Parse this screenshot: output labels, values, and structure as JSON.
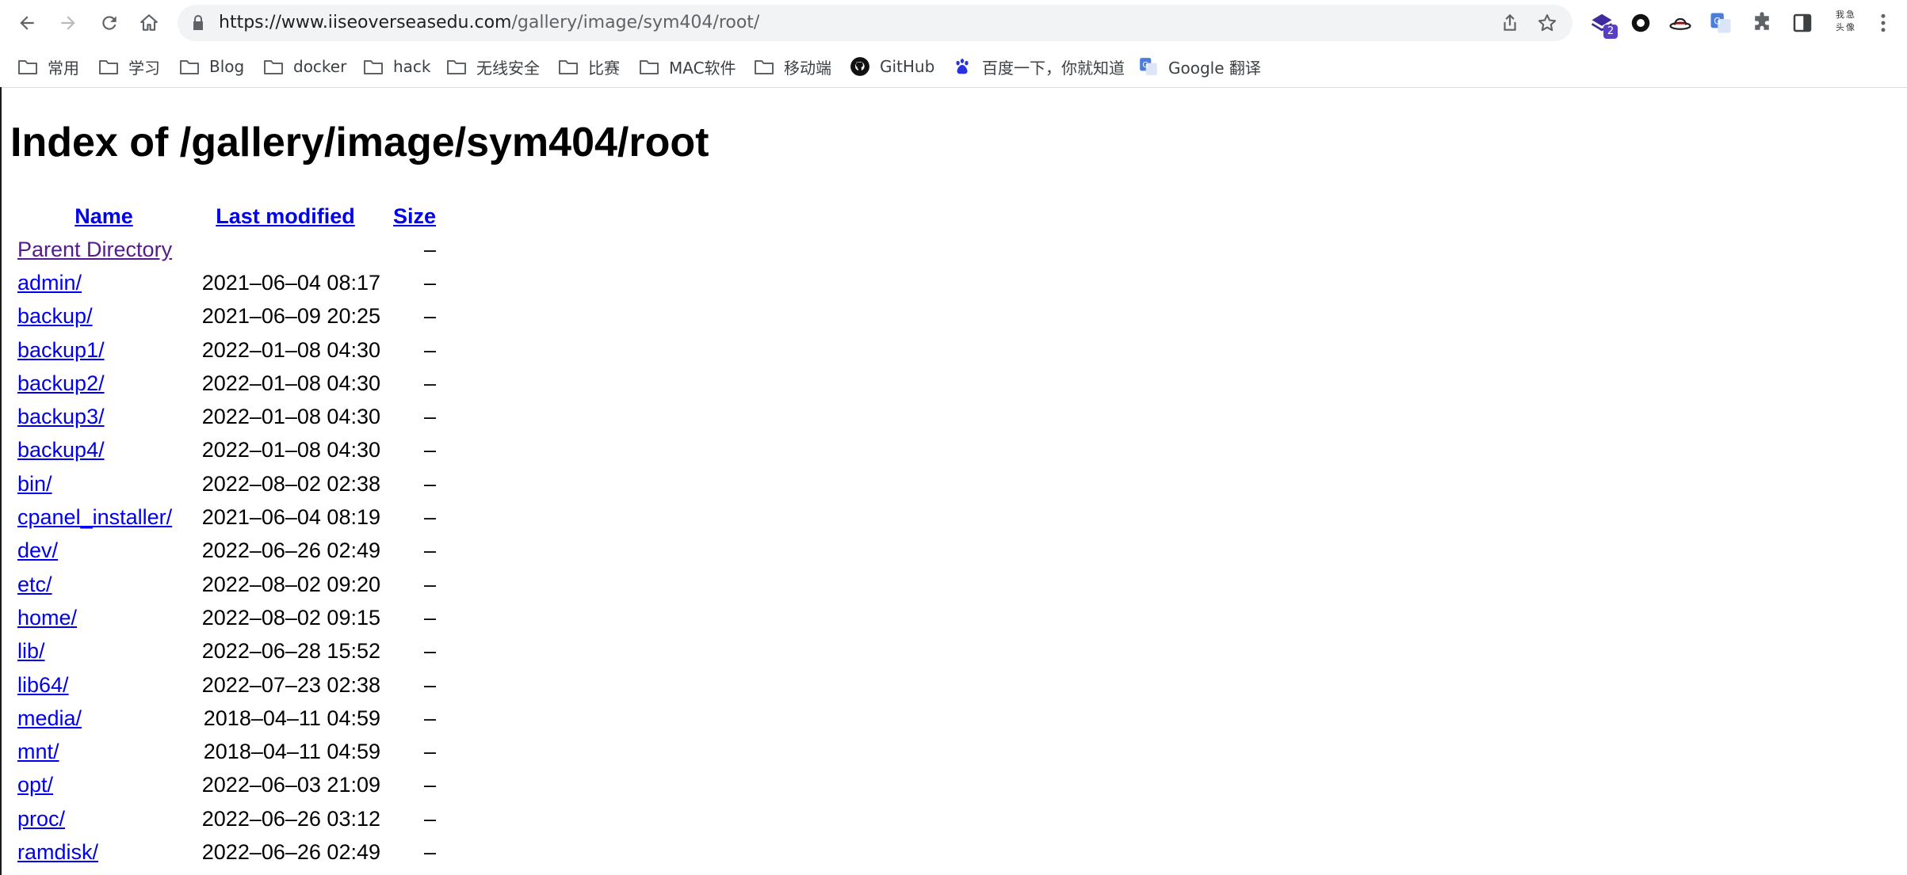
{
  "browser": {
    "url_host": "https://www.iiseoverseasedu.com",
    "url_path": "/gallery/image/sym404/root/",
    "extension_badge": "2",
    "profile_label": "我急头像"
  },
  "bookmarks": [
    {
      "label": "常用",
      "icon": "folder-icon"
    },
    {
      "label": "学习",
      "icon": "folder-icon"
    },
    {
      "label": "Blog",
      "icon": "folder-icon"
    },
    {
      "label": "docker",
      "icon": "folder-icon"
    },
    {
      "label": "hack",
      "icon": "folder-icon"
    },
    {
      "label": "无线安全",
      "icon": "folder-icon"
    },
    {
      "label": "比赛",
      "icon": "folder-icon"
    },
    {
      "label": "MAC软件",
      "icon": "folder-icon"
    },
    {
      "label": "移动端",
      "icon": "folder-icon"
    },
    {
      "label": "GitHub",
      "icon": "github-icon"
    },
    {
      "label": "百度一下，你就知道",
      "icon": "baidu-paw-icon"
    },
    {
      "label": "Google 翻译",
      "icon": "google-translate-icon"
    }
  ],
  "page": {
    "title": "Index of /gallery/image/sym404/root",
    "columns": {
      "name": "Name",
      "modified": "Last modified",
      "size": "Size"
    },
    "parent": {
      "name": "Parent Directory",
      "size": "–"
    },
    "rows": [
      {
        "name": "admin/",
        "modified": "2021–06–04 08:17",
        "size": "–"
      },
      {
        "name": "backup/",
        "modified": "2021–06–09 20:25",
        "size": "–"
      },
      {
        "name": "backup1/",
        "modified": "2022–01–08 04:30",
        "size": "–"
      },
      {
        "name": "backup2/",
        "modified": "2022–01–08 04:30",
        "size": "–"
      },
      {
        "name": "backup3/",
        "modified": "2022–01–08 04:30",
        "size": "–"
      },
      {
        "name": "backup4/",
        "modified": "2022–01–08 04:30",
        "size": "–"
      },
      {
        "name": "bin/",
        "modified": "2022–08–02 02:38",
        "size": "–"
      },
      {
        "name": "cpanel_installer/",
        "modified": "2021–06–04 08:19",
        "size": "–"
      },
      {
        "name": "dev/",
        "modified": "2022–06–26 02:49",
        "size": "–"
      },
      {
        "name": "etc/",
        "modified": "2022–08–02 09:20",
        "size": "–"
      },
      {
        "name": "home/",
        "modified": "2022–08–02 09:15",
        "size": "–"
      },
      {
        "name": "lib/",
        "modified": "2022–06–28 15:52",
        "size": "–"
      },
      {
        "name": "lib64/",
        "modified": "2022–07–23 02:38",
        "size": "–"
      },
      {
        "name": "media/",
        "modified": "2018–04–11 04:59",
        "size": "–"
      },
      {
        "name": "mnt/",
        "modified": "2018–04–11 04:59",
        "size": "–"
      },
      {
        "name": "opt/",
        "modified": "2022–06–03 21:09",
        "size": "–"
      },
      {
        "name": "proc/",
        "modified": "2022–06–26 03:12",
        "size": "–"
      },
      {
        "name": "ramdisk/",
        "modified": "2022–06–26 02:49",
        "size": "–"
      }
    ]
  },
  "colors": {
    "link": "#0000ee",
    "visited_link": "#551a8b",
    "omnibox_bg": "#f1f3f4"
  }
}
